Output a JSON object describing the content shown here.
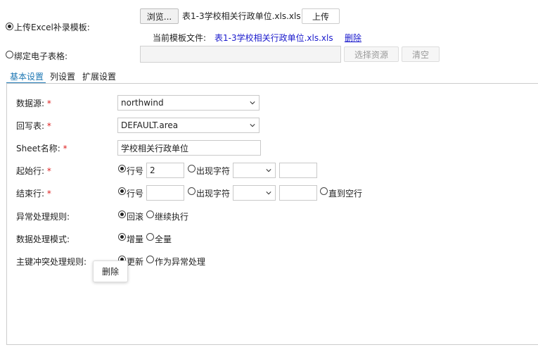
{
  "upload": {
    "radio_label": "上传Excel补录模板:",
    "browse_label": "浏览...",
    "file_name": "表1-3学校相关行政单位.xls.xls",
    "upload_label": "上传",
    "current_template_label": "当前模板文件:",
    "current_template_file": "表1-3学校相关行政单位.xls.xls",
    "delete_link": "删除"
  },
  "bind_sheet": {
    "radio_label": "绑定电子表格:",
    "select_resource_label": "选择资源",
    "clear_label": "清空"
  },
  "tabs": [
    {
      "label": "基本设置",
      "active": true
    },
    {
      "label": "列设置",
      "active": false
    },
    {
      "label": "扩展设置",
      "active": false
    }
  ],
  "form": {
    "datasource_label": "数据源:",
    "datasource_value": "northwind",
    "writeback_label": "回写表:",
    "writeback_value": "DEFAULT.area",
    "sheet_name_label": "Sheet名称:",
    "sheet_name_value": "学校相关行政单位",
    "start_row_label": "起始行:",
    "start_row_option_row": "行号",
    "start_row_value": "2",
    "start_row_option_char": "出现字符",
    "end_row_label": "结束行:",
    "end_row_option_row": "行号",
    "end_row_option_char": "出现字符",
    "end_row_option_empty": "直到空行",
    "error_rule_label": "异常处理规则:",
    "error_rule_rollback": "回滚",
    "error_rule_continue": "继续执行",
    "data_mode_label": "数据处理模式:",
    "data_mode_incremental": "增量",
    "data_mode_full": "全量",
    "pk_conflict_label": "主键冲突处理规则:",
    "pk_conflict_update": "更新",
    "pk_conflict_error": "作为异常处理",
    "required_mark": "*"
  },
  "tooltip": {
    "text": "删除"
  },
  "colors": {
    "accent": "#1f78b4",
    "link": "#1a1acc",
    "required": "#dd2222"
  }
}
